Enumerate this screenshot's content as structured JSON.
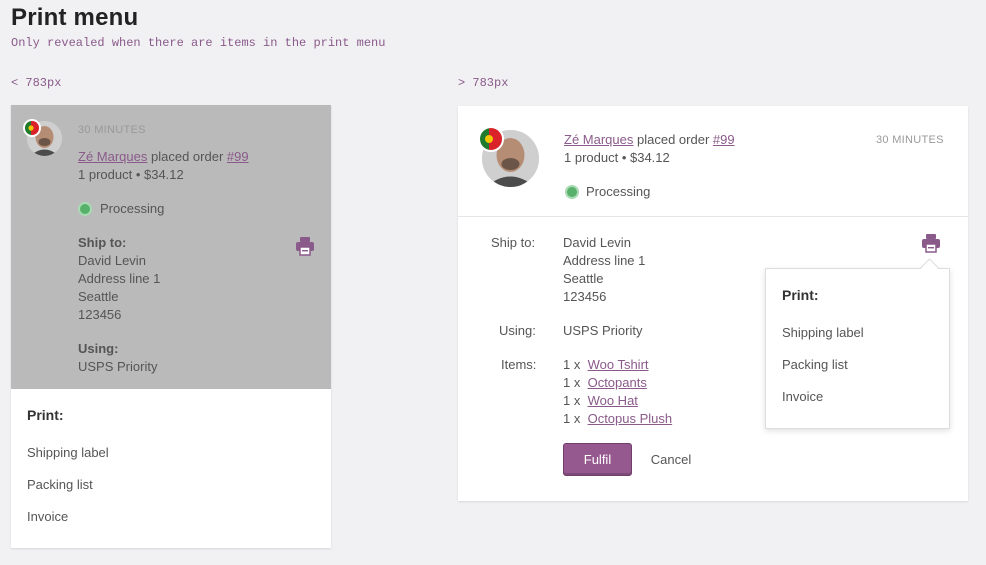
{
  "page": {
    "title": "Print menu",
    "note": "Only revealed when there are items in the print menu",
    "bp_small": "< 783px",
    "bp_large": "> 783px"
  },
  "order": {
    "time": "30 MINUTES",
    "customer": "Zé Marques",
    "placed_text": "placed order",
    "number": "#99",
    "summary": "1 product • $34.12",
    "status": "Processing"
  },
  "shipping": {
    "ship_label_small": "Ship to:",
    "ship_label_large": "Ship to:",
    "name": "David Levin",
    "address1": "Address line 1",
    "city": "Seattle",
    "zip": "123456",
    "using_label_small": "Using:",
    "using_label_large": "Using:",
    "method": "USPS Priority",
    "items_label": "Items:"
  },
  "items": [
    {
      "qty": "1 x",
      "name": "Woo Tshirt"
    },
    {
      "qty": "1 x",
      "name": "Octopants"
    },
    {
      "qty": "1 x",
      "name": "Woo Hat"
    },
    {
      "qty": "1 x",
      "name": "Octopus Plush"
    }
  ],
  "print_menu": {
    "title": "Print:",
    "options": [
      "Shipping label",
      "Packing list",
      "Invoice"
    ]
  },
  "actions": {
    "fulfil": "Fulfil",
    "cancel": "Cancel"
  },
  "colors": {
    "accent": "#95598f",
    "link": "#8a5a8a",
    "status_green": "#58b16a",
    "overlay": "#bababa",
    "background": "#f1f1f4"
  },
  "icons": {
    "print": "printer-icon",
    "flag": "portugal-flag-icon",
    "avatar": "customer-avatar",
    "status": "status-dot-icon"
  }
}
